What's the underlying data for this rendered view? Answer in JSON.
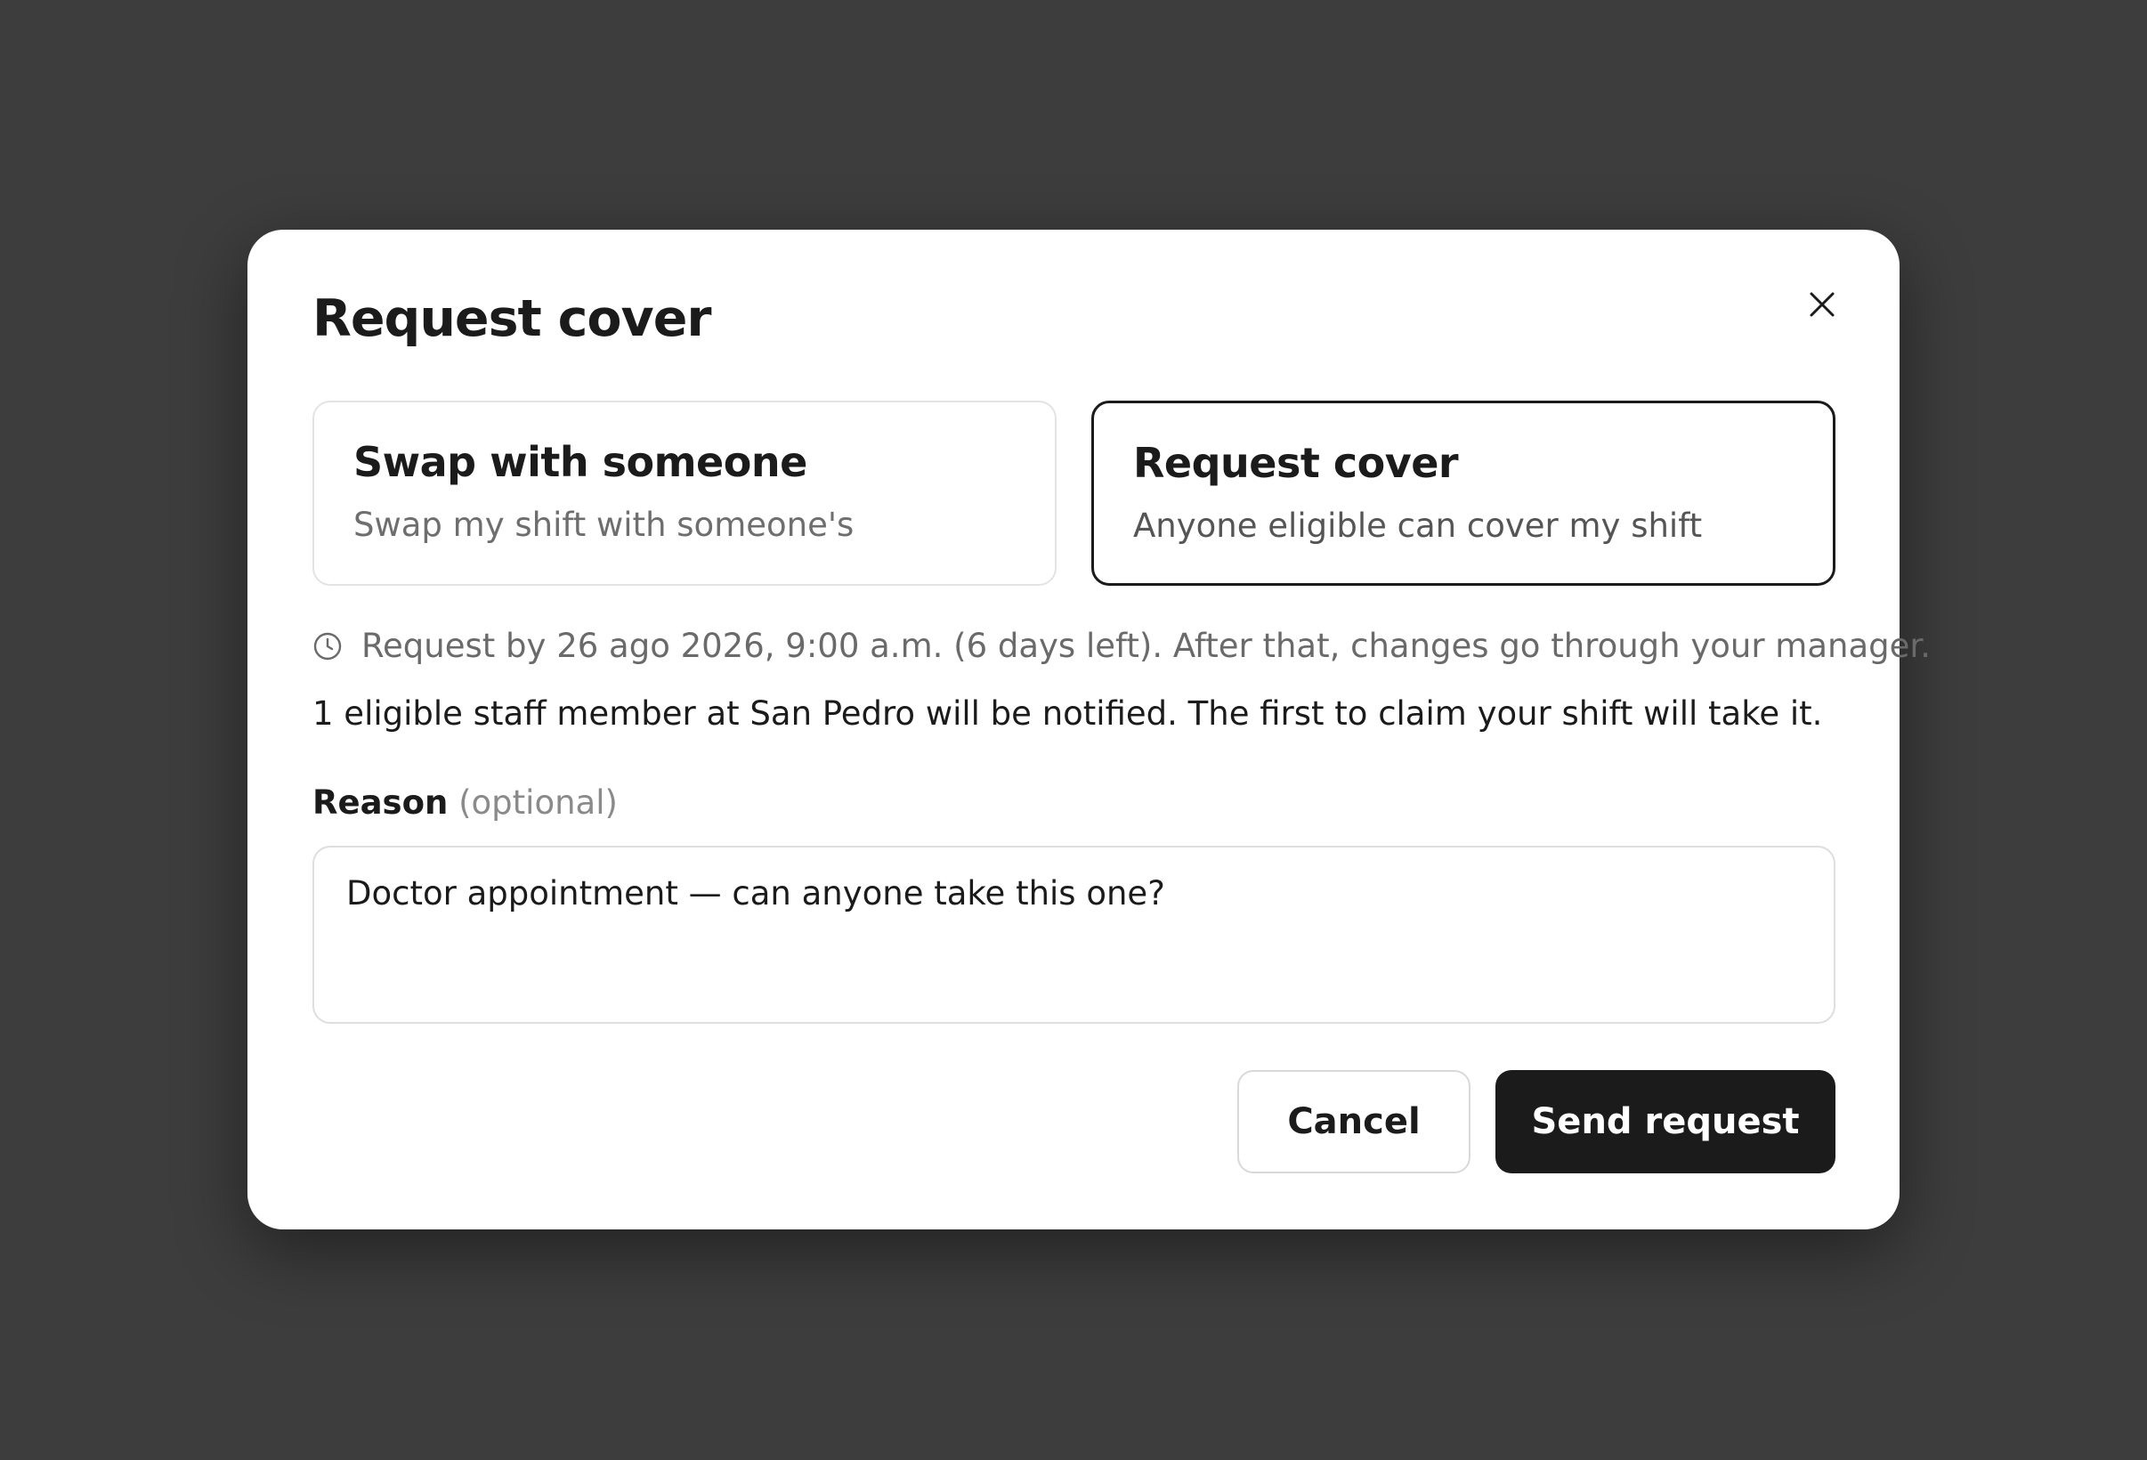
{
  "modal": {
    "title": "Request cover",
    "close_icon": "close-icon"
  },
  "options": {
    "swap": {
      "title": "Swap with someone",
      "description": "Swap my shift with someone's",
      "selected": false
    },
    "cover": {
      "title": "Request cover",
      "description": "Anyone eligible can cover my shift",
      "selected": true
    }
  },
  "deadline": {
    "icon": "clock-icon",
    "text": "Request by 26 ago 2026, 9:00 a.m. (6 days left). After that, changes go through your manager."
  },
  "notify_text": "1 eligible staff member at San Pedro will be notified. The first to claim your shift will take it.",
  "reason": {
    "label": "Reason",
    "optional_hint": "(optional)",
    "value": "Doctor appointment — can anyone take this one?"
  },
  "actions": {
    "cancel_label": "Cancel",
    "send_label": "Send request"
  },
  "colors": {
    "backdrop": "#3d3d3d",
    "primary_button": "#1b1b1b",
    "selected_border": "#1b1b1b",
    "muted_text": "#6a6a6a"
  }
}
